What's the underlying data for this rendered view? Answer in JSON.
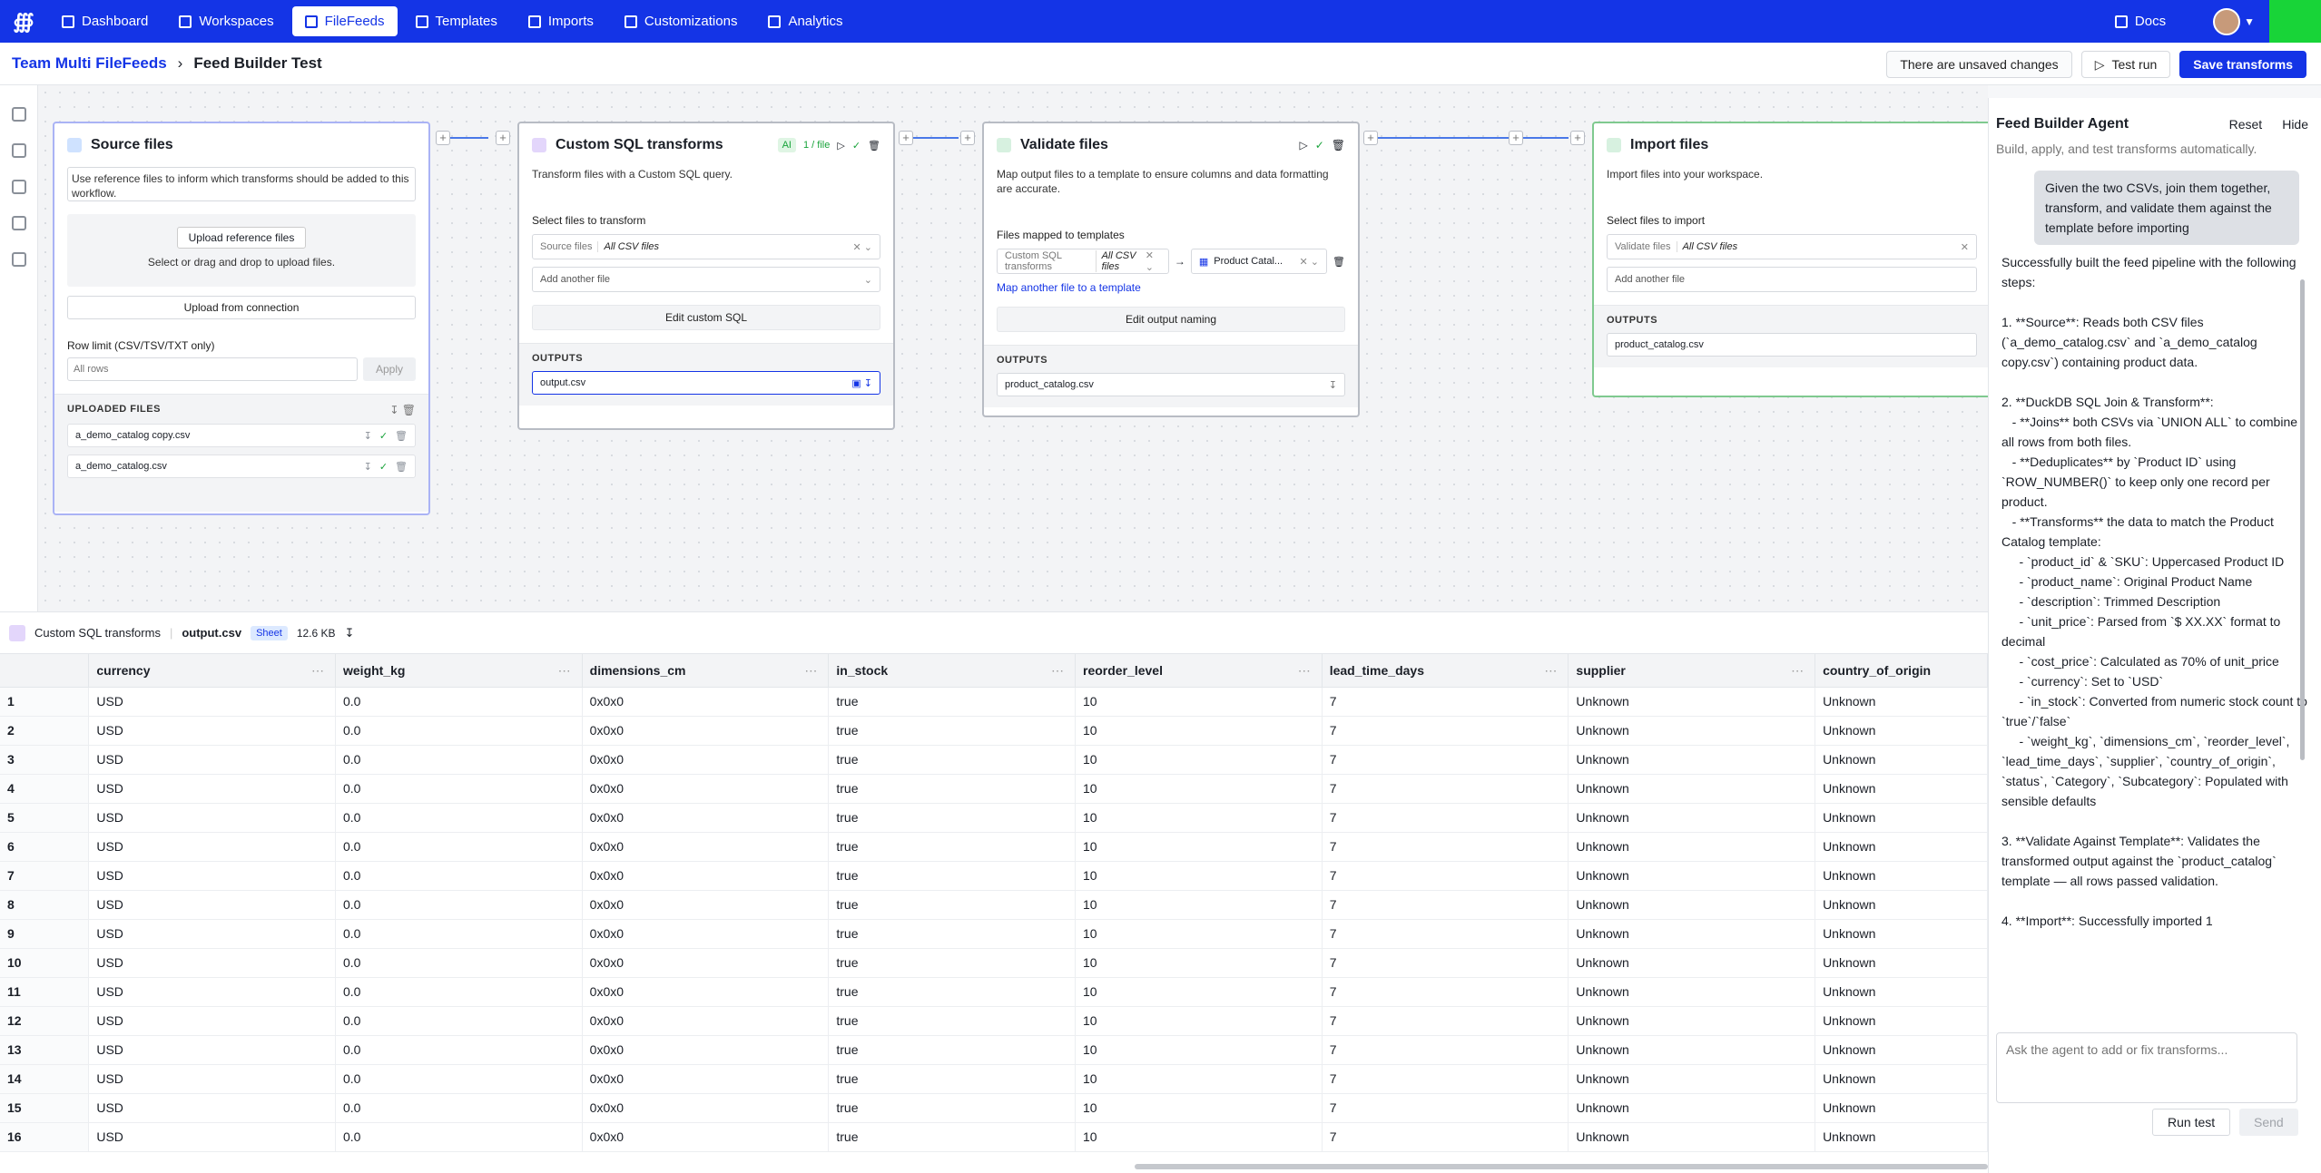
{
  "nav": {
    "items": [
      {
        "label": "Dashboard",
        "icon": "grid-icon"
      },
      {
        "label": "Workspaces",
        "icon": "briefcase-icon"
      },
      {
        "label": "FileFeeds",
        "icon": "flow-icon",
        "active": true
      },
      {
        "label": "Templates",
        "icon": "table-icon"
      },
      {
        "label": "Imports",
        "icon": "list-icon"
      },
      {
        "label": "Customizations",
        "icon": "tools-icon"
      },
      {
        "label": "Analytics",
        "icon": "chart-icon"
      }
    ],
    "docs": "Docs",
    "brand_color": "#1434e6"
  },
  "breadcrumb": {
    "parent": "Team Multi FileFeeds",
    "current": "Feed Builder Test"
  },
  "header": {
    "unsaved": "There are unsaved changes",
    "test_run": "Test run",
    "save": "Save transforms"
  },
  "cards": {
    "source": {
      "title": "Source files",
      "desc": "Use reference files to inform which transforms should be added to this workflow.",
      "upload_btn": "Upload reference files",
      "upload_hint": "Select or drag and drop to upload files.",
      "upload_conn": "Upload from connection",
      "row_limit": "Row limit (CSV/TSV/TXT only)",
      "row_placeholder": "All rows",
      "apply": "Apply",
      "uploaded": "UPLOADED FILES",
      "files": [
        "a_demo_catalog copy.csv",
        "a_demo_catalog.csv"
      ]
    },
    "sql": {
      "title": "Custom SQL transforms",
      "ai_badge": "AI",
      "file_count": "1 / file",
      "desc": "Transform files with a Custom SQL query.",
      "select_label": "Select files to transform",
      "src_prefix": "Source files",
      "src_value": "All CSV files",
      "add_another": "Add another file",
      "edit_btn": "Edit custom SQL",
      "outputs": "OUTPUTS",
      "output_file": "output.csv"
    },
    "validate": {
      "title": "Validate files",
      "desc": "Map output files to a template to ensure columns and data formatting are accurate.",
      "select_label": "Files mapped to templates",
      "src_prefix": "Custom SQL transforms",
      "src_value": "All CSV files",
      "template": "Product Catal...",
      "map_link": "Map another file to a template",
      "edit_btn": "Edit output naming",
      "outputs": "OUTPUTS",
      "output_file": "product_catalog.csv"
    },
    "import": {
      "title": "Import files",
      "desc": "Import files into your workspace.",
      "select_label": "Select files to import",
      "src_prefix": "Validate files",
      "src_value": "All CSV files",
      "add_another": "Add another file",
      "outputs": "OUTPUTS",
      "output_file": "product_catalog.csv"
    }
  },
  "preview": {
    "step": "Custom SQL transforms",
    "file": "output.csv",
    "tag": "Sheet",
    "size": "12.6 KB",
    "columns": [
      "currency",
      "weight_kg",
      "dimensions_cm",
      "in_stock",
      "reorder_level",
      "lead_time_days",
      "supplier",
      "country_of_origin"
    ],
    "row": [
      "USD",
      "0.0",
      "0x0x0",
      "true",
      "10",
      "7",
      "Unknown",
      "Unknown"
    ],
    "row_numbers": [
      "1",
      "2",
      "3",
      "4",
      "5",
      "6",
      "7",
      "8",
      "9",
      "10",
      "11",
      "12",
      "13",
      "14",
      "15",
      "16"
    ]
  },
  "agent": {
    "title": "Feed Builder Agent",
    "reset": "Reset",
    "hide": "Hide",
    "subtitle": "Build, apply, and test transforms automatically.",
    "user_msg": "Given the two CSVs, join them together, transform, and validate them against the template before importing",
    "reply": "Successfully built the feed pipeline with the following steps:\n\n1. **Source**: Reads both CSV files (`a_demo_catalog.csv` and `a_demo_catalog copy.csv`) containing product data.\n\n2. **DuckDB SQL Join & Transform**:\n   - **Joins** both CSVs via `UNION ALL` to combine all rows from both files.\n   - **Deduplicates** by `Product ID` using `ROW_NUMBER()` to keep only one record per product.\n   - **Transforms** the data to match the Product Catalog template:\n     - `product_id` & `SKU`: Uppercased Product ID\n     - `product_name`: Original Product Name\n     - `description`: Trimmed Description\n     - `unit_price`: Parsed from `$ XX.XX` format to decimal\n     - `cost_price`: Calculated as 70% of unit_price\n     - `currency`: Set to `USD`\n     - `in_stock`: Converted from numeric stock count to `true`/`false`\n     - `weight_kg`, `dimensions_cm`, `reorder_level`, `lead_time_days`, `supplier`, `country_of_origin`, `status`, `Category`, `Subcategory`: Populated with sensible defaults\n\n3. **Validate Against Template**: Validates the transformed output against the `product_catalog` template — all rows passed validation.\n\n4. **Import**: Successfully imported 1",
    "input_placeholder": "Ask the agent to add or fix transforms...",
    "run_test": "Run test",
    "send": "Send"
  }
}
